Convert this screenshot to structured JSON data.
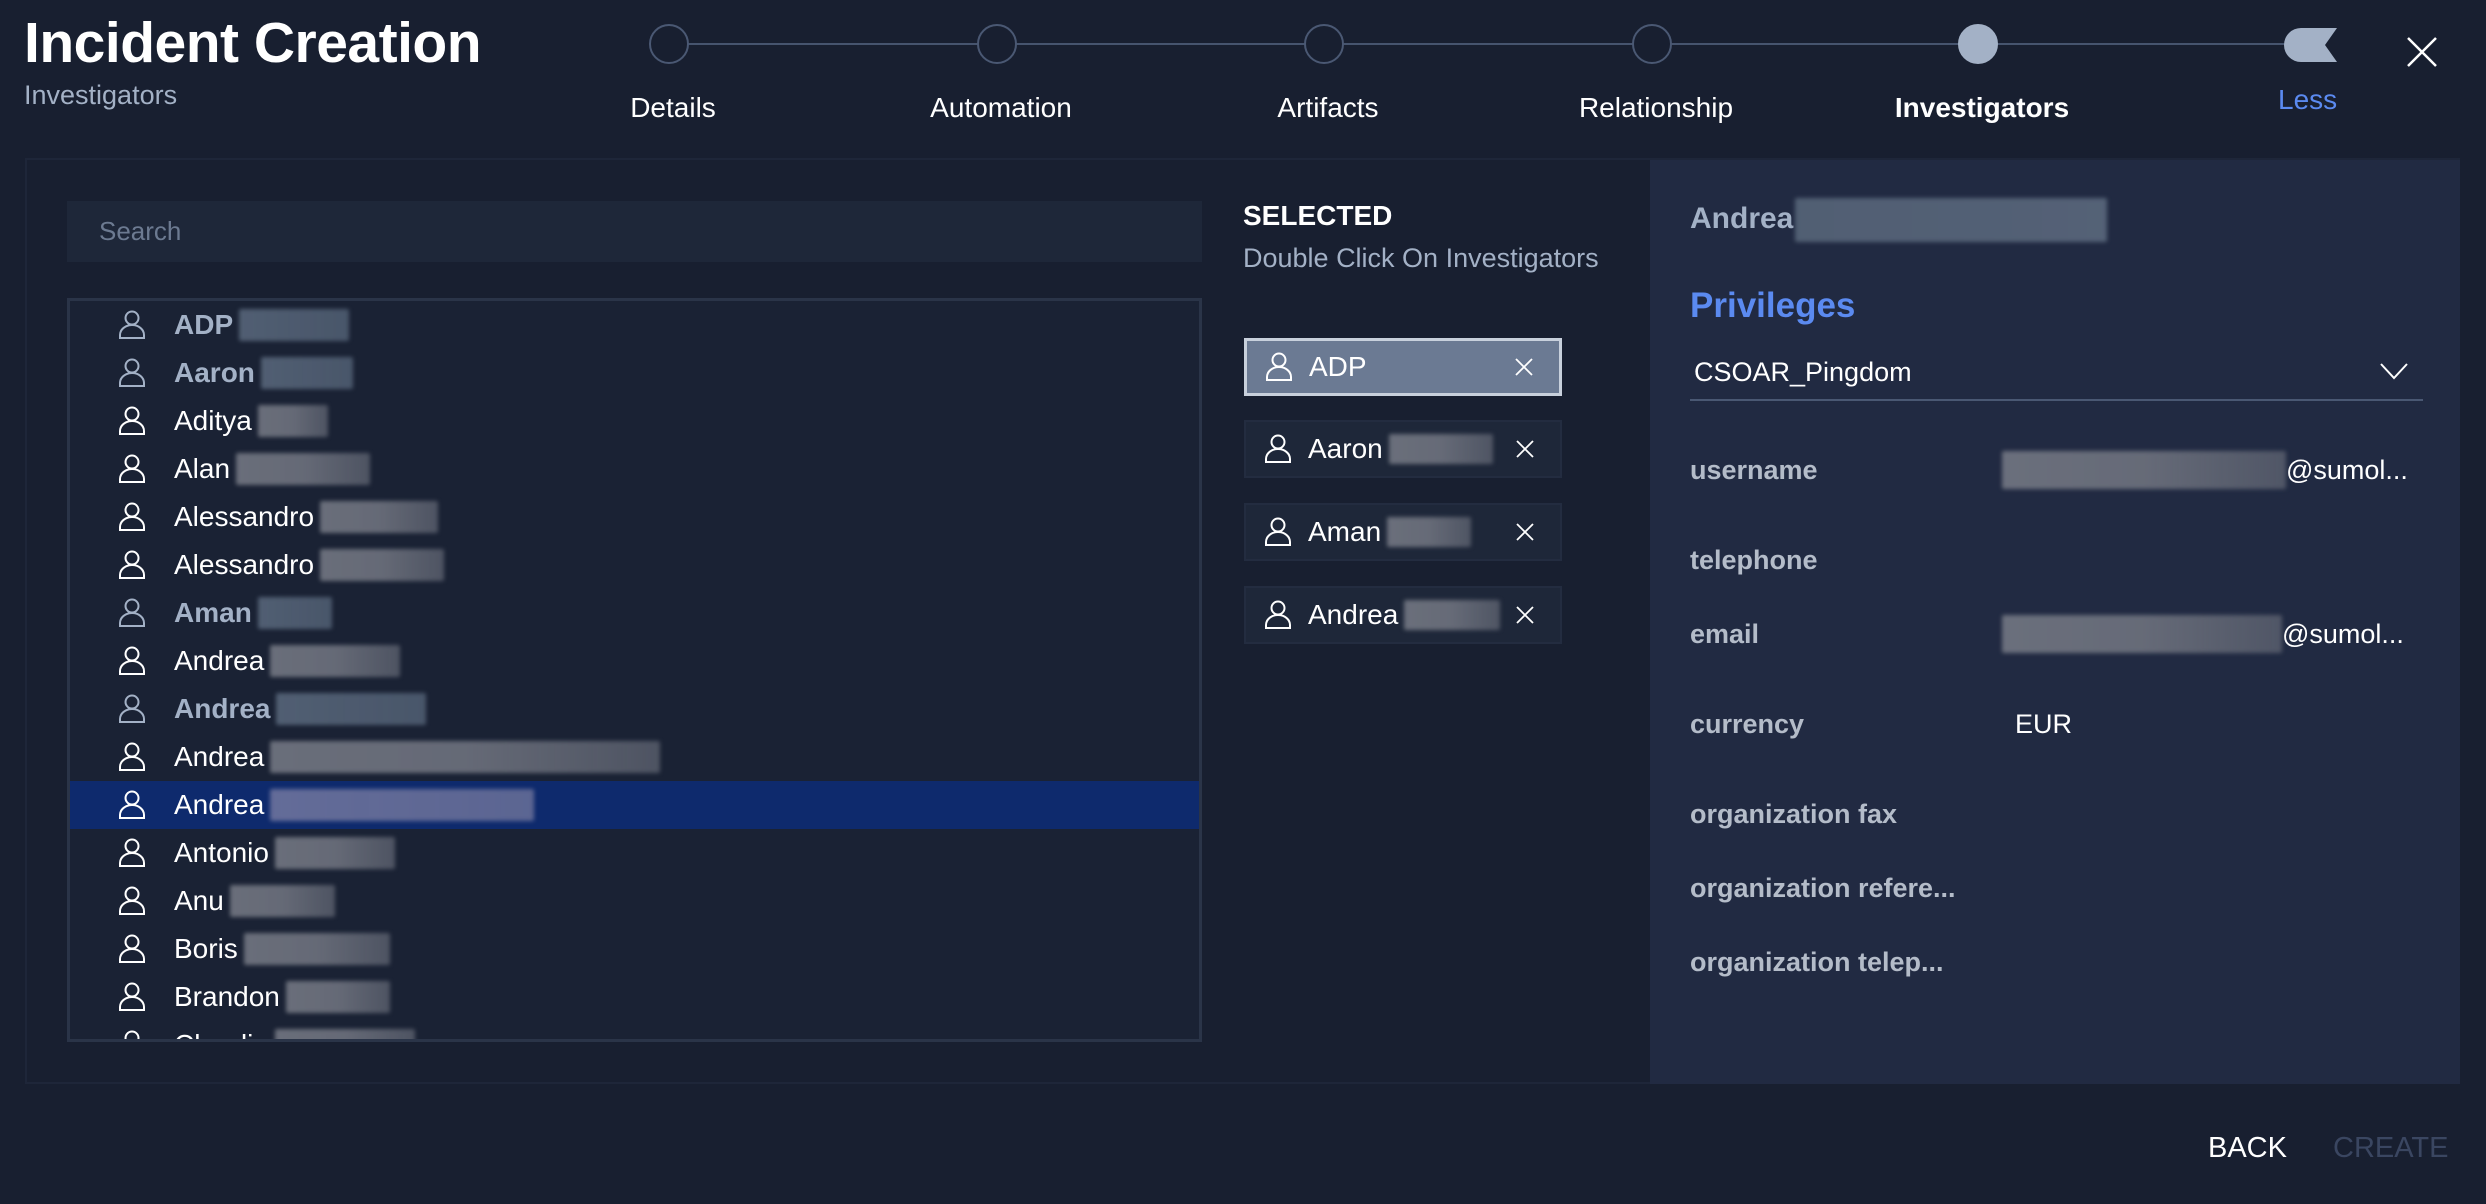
{
  "header": {
    "title": "Incident Creation",
    "subtitle": "Investigators",
    "close_icon": "close-icon"
  },
  "stepper": {
    "steps": [
      {
        "label": "Details",
        "state": "incomplete"
      },
      {
        "label": "Automation",
        "state": "incomplete"
      },
      {
        "label": "Artifacts",
        "state": "incomplete"
      },
      {
        "label": "Relationship",
        "state": "incomplete"
      },
      {
        "label": "Investigators",
        "state": "active"
      }
    ],
    "toggle_label": "Less",
    "toggle_icon": "flag-icon"
  },
  "search": {
    "placeholder": "Search",
    "value": ""
  },
  "investigators": {
    "items": [
      {
        "name": "ADP",
        "added": true,
        "highlighted": false,
        "redacted": true
      },
      {
        "name": "Aaron",
        "added": true,
        "highlighted": false,
        "redacted": true
      },
      {
        "name": "Aditya",
        "added": false,
        "highlighted": false,
        "redacted": true
      },
      {
        "name": "Alan",
        "added": false,
        "highlighted": false,
        "redacted": true
      },
      {
        "name": "Alessandro",
        "added": false,
        "highlighted": false,
        "redacted": true
      },
      {
        "name": "Alessandro",
        "added": false,
        "highlighted": false,
        "redacted": true
      },
      {
        "name": "Aman",
        "added": true,
        "highlighted": false,
        "redacted": true
      },
      {
        "name": "Andrea",
        "added": false,
        "highlighted": false,
        "redacted": true
      },
      {
        "name": "Andrea",
        "added": true,
        "highlighted": false,
        "redacted": true
      },
      {
        "name": "Andrea",
        "added": false,
        "highlighted": false,
        "redacted": true
      },
      {
        "name": "Andrea",
        "added": false,
        "highlighted": true,
        "redacted": true
      },
      {
        "name": "Antonio",
        "added": false,
        "highlighted": false,
        "redacted": true
      },
      {
        "name": "Anu",
        "added": false,
        "highlighted": false,
        "redacted": true
      },
      {
        "name": "Boris",
        "added": false,
        "highlighted": false,
        "redacted": true
      },
      {
        "name": "Brandon",
        "added": false,
        "highlighted": false,
        "redacted": true
      },
      {
        "name": "Claudio",
        "added": false,
        "highlighted": false,
        "redacted": true
      }
    ]
  },
  "selected": {
    "title": "SELECTED",
    "hint": "Double Click On Investigators",
    "chips": [
      {
        "name": "ADP",
        "focused": true,
        "redacted": false
      },
      {
        "name": "Aaron",
        "focused": false,
        "redacted": true
      },
      {
        "name": "Aman",
        "focused": false,
        "redacted": true
      },
      {
        "name": "Andrea",
        "focused": false,
        "redacted": true
      }
    ]
  },
  "detail": {
    "name": "Andrea",
    "privileges_title": "Privileges",
    "privilege_selected": "CSOAR_Pingdom",
    "fields": [
      {
        "label": "username",
        "value": "@sumol...",
        "redacted": true
      },
      {
        "label": "telephone",
        "value": "",
        "redacted": false
      },
      {
        "label": "email",
        "value": "@sumol...",
        "redacted": true
      },
      {
        "label": "currency",
        "value": "EUR",
        "redacted": false
      },
      {
        "label": "organization fax",
        "value": "",
        "redacted": false
      },
      {
        "label": "organization refere...",
        "value": "",
        "redacted": false
      },
      {
        "label": "organization telep...",
        "value": "",
        "redacted": false
      }
    ]
  },
  "footer": {
    "back_label": "BACK",
    "create_label": "CREATE",
    "create_enabled": false
  },
  "colors": {
    "background": "#181f30",
    "panel": "#212a42",
    "accent": "#5b8af0",
    "highlight_row": "#0e2a6d",
    "muted_text": "#a3b1c6",
    "disabled": "#3a4661"
  }
}
